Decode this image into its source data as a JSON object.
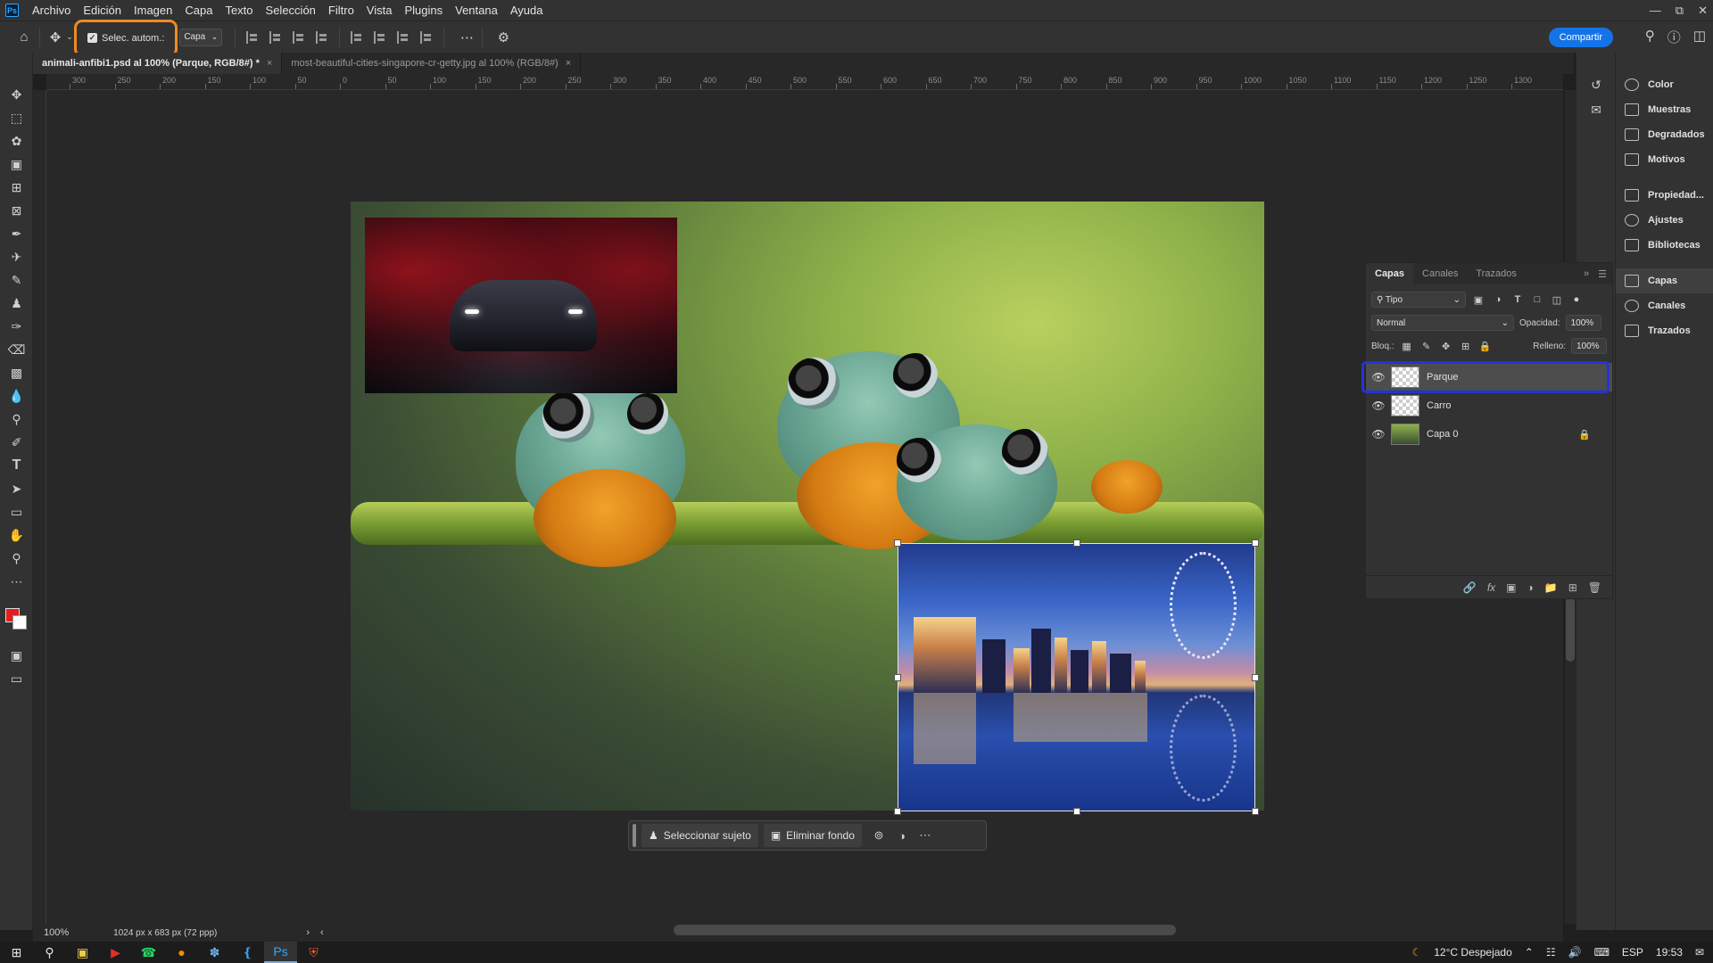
{
  "menu": {
    "logo": "Ps",
    "items": [
      "Archivo",
      "Edición",
      "Imagen",
      "Capa",
      "Texto",
      "Selección",
      "Filtro",
      "Vista",
      "Plugins",
      "Ventana",
      "Ayuda"
    ]
  },
  "options": {
    "auto_select_label": "Selec. autom.:",
    "auto_select_checked": true,
    "target_value": "Capa",
    "share_label": "Compartir"
  },
  "tabs": [
    {
      "label": "animali-anfibi1.psd al 100% (Parque, RGB/8#) *",
      "close": "×",
      "active": true
    },
    {
      "label": "most-beautiful-cities-singapore-cr-getty.jpg al 100% (RGB/8#)",
      "close": "×",
      "active": false
    }
  ],
  "ruler": {
    "top_ticks": [
      "300",
      "250",
      "200",
      "150",
      "100",
      "50",
      "0",
      "50",
      "100",
      "150",
      "200",
      "250",
      "300",
      "350",
      "400",
      "450",
      "500",
      "550",
      "600",
      "650",
      "700",
      "750",
      "800",
      "850",
      "900",
      "950",
      "1000",
      "1050",
      "1100",
      "1150",
      "1200",
      "1250",
      "1300"
    ]
  },
  "context_bar": {
    "select_subject": "Seleccionar sujeto",
    "remove_bg": "Eliminar fondo"
  },
  "status": {
    "zoom": "100%",
    "doc_info": "1024 px x 683 px (72 ppp)"
  },
  "right_column": {
    "group1": [
      "Color",
      "Muestras",
      "Degradados",
      "Motivos"
    ],
    "group2": [
      "Propiedad...",
      "Ajustes",
      "Bibliotecas"
    ],
    "group3": [
      "Capas",
      "Canales",
      "Trazados"
    ]
  },
  "layers_panel": {
    "tabs": [
      "Capas",
      "Canales",
      "Trazados"
    ],
    "filter_kind": "Tipo",
    "blend_mode": "Normal",
    "opacity_label": "Opacidad:",
    "opacity_value": "100%",
    "lock_label": "Bloq.:",
    "fill_label": "Relleno:",
    "fill_value": "100%",
    "layers": [
      {
        "name": "Parque",
        "selected": true,
        "locked": false
      },
      {
        "name": "Carro",
        "selected": false,
        "locked": false
      },
      {
        "name": "Capa 0",
        "selected": false,
        "locked": true
      }
    ]
  },
  "taskbar": {
    "weather": "12°C  Despejado",
    "lang": "ESP",
    "time": "19:53"
  },
  "colors": {
    "foreground": "#e01e1e",
    "background": "#ffffff",
    "accent": "#1473e6",
    "annotation_orange": "#f08a24",
    "annotation_blue": "#2334d6"
  }
}
